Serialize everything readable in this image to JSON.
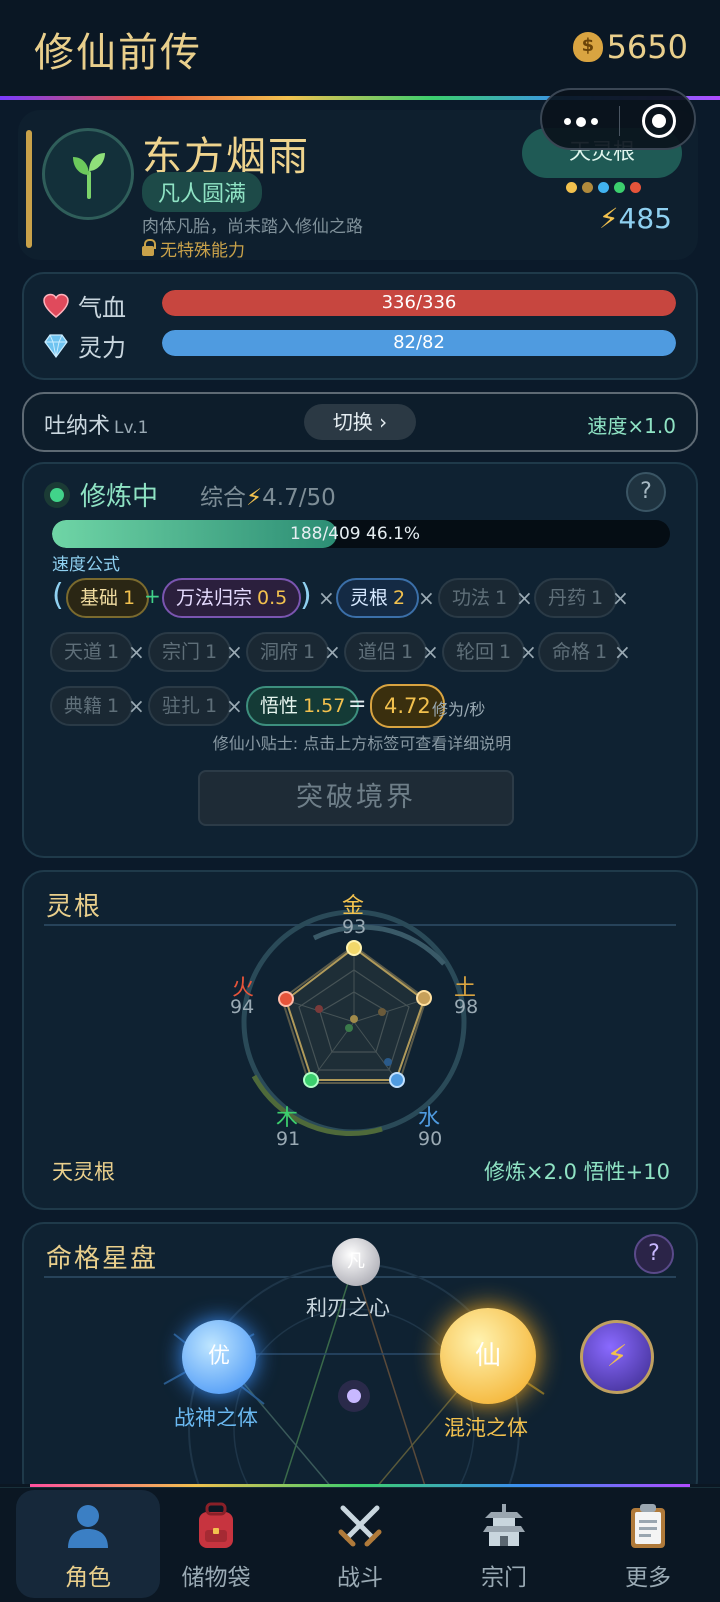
{
  "app": {
    "title": "修仙前传",
    "coins": "5650"
  },
  "profile": {
    "name": "东方烟雨",
    "realm": "凡人圆满",
    "description": "肉体凡胎，尚未踏入修仙之路",
    "ability": "无特殊能力",
    "root_badge": "天灵根",
    "root_dots": [
      "#f2c14e",
      "#b08a3c",
      "#41b3f0",
      "#3ccf6e",
      "#e6543a"
    ],
    "power": "485"
  },
  "stats": {
    "hp": {
      "label": "气血",
      "text": "336/336",
      "current": 336,
      "max": 336,
      "color": "#c7463f"
    },
    "mp": {
      "label": "灵力",
      "text": "82/82",
      "current": 82,
      "max": 82,
      "color": "#4f9be0"
    }
  },
  "technique": {
    "name": "吐纳术",
    "level": "Lv.1",
    "switch_label": "切换 ›",
    "speed": "速度×1.0"
  },
  "cultivation": {
    "status": "修炼中",
    "total_prefix": "综合",
    "total_value": "4.7/50",
    "progress_text": "188/409  46.1%",
    "progress_percent": 46.1,
    "formula_label": "速度公式",
    "chips": {
      "base": {
        "name": "基础",
        "value": "1"
      },
      "wanfa": {
        "name": "万法归宗",
        "value": "0.5"
      },
      "linggen": {
        "name": "灵根",
        "value": "2"
      },
      "gongfa": {
        "name": "功法",
        "value": "1"
      },
      "danyao": {
        "name": "丹药",
        "value": "1"
      },
      "tiandao": {
        "name": "天道",
        "value": "1"
      },
      "zongmen": {
        "name": "宗门",
        "value": "1"
      },
      "dongfu": {
        "name": "洞府",
        "value": "1"
      },
      "daolv": {
        "name": "道侣",
        "value": "1"
      },
      "lunhui": {
        "name": "轮回",
        "value": "1"
      },
      "mingge": {
        "name": "命格",
        "value": "1"
      },
      "dianji": {
        "name": "典籍",
        "value": "1"
      },
      "zhuzha": {
        "name": "驻扎",
        "value": "1"
      },
      "wuxing": {
        "name": "悟性",
        "value": "1.57"
      }
    },
    "result_value": "4.72",
    "result_unit": "修为/秒",
    "tip": "修仙小贴士: 点击上方标签可查看详细说明",
    "breakthrough_label": "突破境界"
  },
  "linggen": {
    "title": "灵根",
    "type_label": "天灵根",
    "bonus": "修炼×2.0  悟性+10",
    "elements": [
      {
        "name": "金",
        "value": "93",
        "color": "#f2c14e"
      },
      {
        "name": "土",
        "value": "98",
        "color": "#d9a441"
      },
      {
        "name": "水",
        "value": "90",
        "color": "#4f9be0"
      },
      {
        "name": "木",
        "value": "91",
        "color": "#3ccf6e"
      },
      {
        "name": "火",
        "value": "94",
        "color": "#e6543a"
      }
    ]
  },
  "starchart": {
    "title": "命格星盘",
    "orbs": {
      "top": {
        "glyph": "凡",
        "label": "利刃之心"
      },
      "left": {
        "glyph": "优",
        "label": "战神之体"
      },
      "right": {
        "glyph": "仙",
        "label": "混沌之体"
      }
    }
  },
  "nav": [
    {
      "label": "角色",
      "icon": "person-icon",
      "active": true
    },
    {
      "label": "储物袋",
      "icon": "backpack-icon",
      "active": false
    },
    {
      "label": "战斗",
      "icon": "crossed-swords-icon",
      "active": false
    },
    {
      "label": "宗门",
      "icon": "pagoda-icon",
      "active": false
    },
    {
      "label": "更多",
      "icon": "clipboard-icon",
      "active": false
    }
  ]
}
